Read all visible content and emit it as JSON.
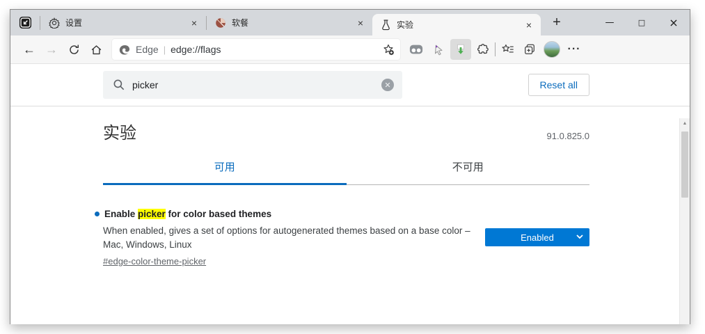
{
  "window": {
    "controls": {
      "minimize": "—",
      "maximize": "□",
      "close": "×"
    }
  },
  "tab_bar": {
    "tabs": [
      {
        "title": "设置"
      },
      {
        "title": "软餐"
      },
      {
        "title": "实验"
      }
    ],
    "close_glyph": "×",
    "new_tab_glyph": "+"
  },
  "toolbar": {
    "address_bar": {
      "site_label": "Edge",
      "separator": "|",
      "url": "edge://flags"
    },
    "more_glyph": "···"
  },
  "flags_page": {
    "search_value": "picker",
    "clear_glyph": "✕",
    "reset_all_label": "Reset all",
    "page_title": "实验",
    "version": "91.0.825.0",
    "section_tabs": [
      {
        "label": "可用",
        "active": true
      },
      {
        "label": "不可用",
        "active": false
      }
    ],
    "flag": {
      "title_before": "Enable ",
      "title_highlight": "picker",
      "title_after": " for color based themes",
      "description_lines": [
        "When enabled, gives a set of options for autogenerated themes based on a base color –",
        "Mac, Windows, Linux"
      ],
      "link": "#edge-color-theme-picker",
      "state_value": "Enabled"
    },
    "scroll_up_glyph": "▲",
    "colors": {
      "accent_blue": "#0078d4",
      "highlight_yellow": "#ffff00"
    }
  }
}
